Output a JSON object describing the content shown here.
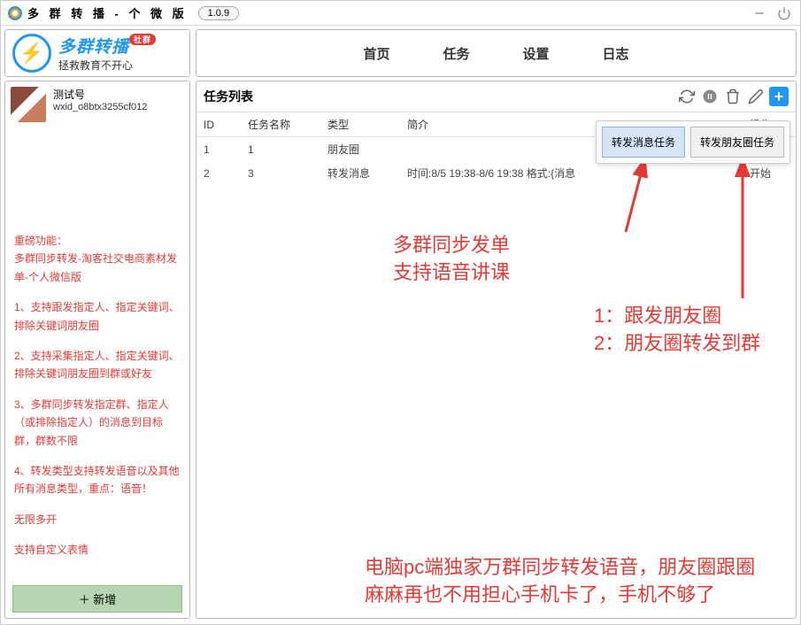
{
  "titlebar": {
    "title": "多 群 转 播 - 个 微 版",
    "version": "1.0.9"
  },
  "brand": {
    "name": "多群转播",
    "badge": "社群",
    "slogan": "拯救教育不开心"
  },
  "nav": {
    "items": [
      "首页",
      "任务",
      "设置",
      "日志"
    ]
  },
  "sidebar": {
    "account_name": "测试号",
    "account_wxid": "wxid_o8btx3255cf012",
    "features_title": "重磅功能：",
    "features_sub": "多群同步转发-淘客社交电商素材发单-个人微信版",
    "features": [
      "1、支持跟发指定人、指定关键词、排除关键词朋友圈",
      "2、支持采集指定人、指定关键词、排除关键词朋友圈到群或好友",
      "3、多群同步转发指定群、指定人（或排除指定人）的消息到目标群，群数不限",
      "4、转发类型支持转发语音以及其他所有消息类型，重点：语音！",
      "无限多开",
      "支持自定义表情"
    ],
    "add_button": "＋ 新增"
  },
  "content": {
    "title": "任务列表",
    "headers": {
      "id": "ID",
      "name": "任务名称",
      "type": "类型",
      "desc": "简介",
      "op": "操作"
    },
    "rows": [
      {
        "id": "1",
        "name": "1",
        "type": "朋友圈",
        "desc": "",
        "op": ""
      },
      {
        "id": "2",
        "name": "3",
        "type": "转发消息",
        "desc": "时间:8/5 19:38-8/6 19:38 格式:{消息",
        "op": "开始"
      }
    ],
    "popup": {
      "btn_msg": "转发消息任务",
      "btn_moments": "转发朋友圈任务"
    }
  },
  "annotations": {
    "a1": "多群同步发单\n支持语音讲课",
    "a2": "1：跟发朋友圈\n2：朋友圈转发到群",
    "a3": "电脑pc端独家万群同步转发语音，朋友圈跟圈\n麻麻再也不用担心手机卡了，手机不够了"
  }
}
